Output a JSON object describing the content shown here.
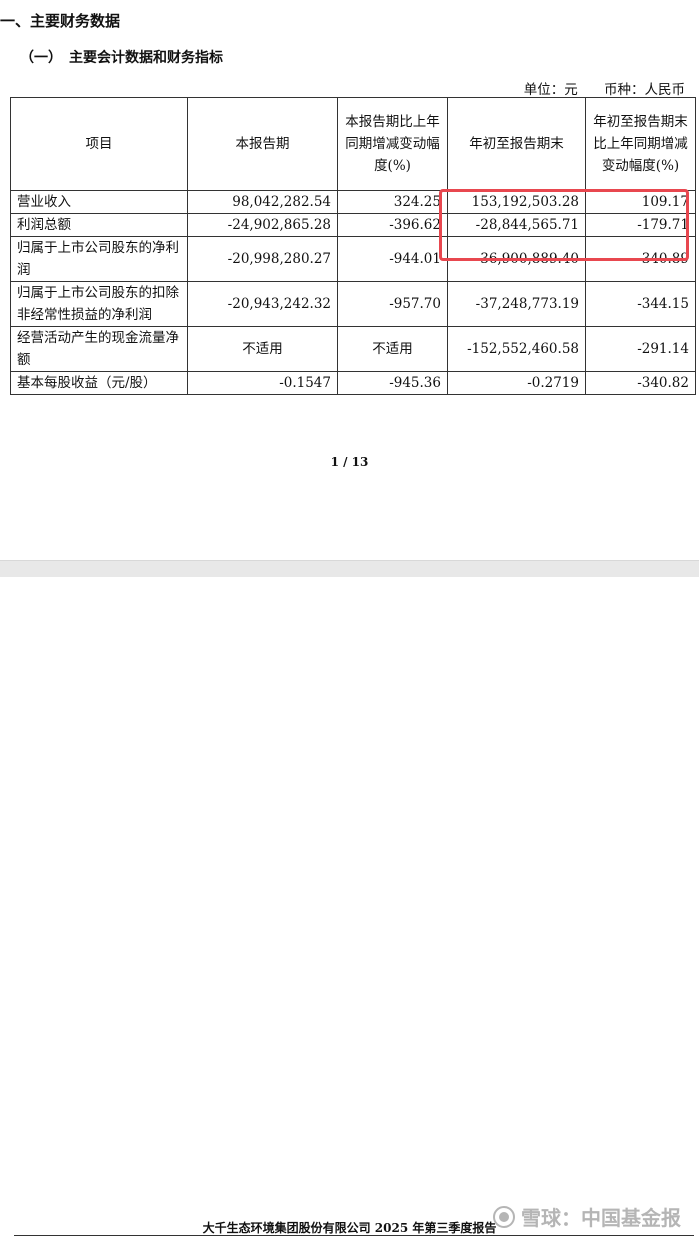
{
  "section_title": "一、主要财务数据",
  "sub_title": "（一）　主要会计数据和财务指标",
  "unit": {
    "unit_text": "单位：元",
    "currency_text": "币种：人民币"
  },
  "table": {
    "headers": [
      "项目",
      "本报告期",
      "本报告期比上年同期增减变动幅度(%)",
      "年初至报告期末",
      "年初至报告期末比上年同期增减变动幅度(%)"
    ],
    "rows": [
      {
        "label": "营业收入",
        "current": "98,042,282.54",
        "current_change": "324.25",
        "ytd": "153,192,503.28",
        "ytd_change": "109.17"
      },
      {
        "label": "利润总额",
        "current": "-24,902,865.28",
        "current_change": "-396.62",
        "ytd": "-28,844,565.71",
        "ytd_change": "-179.71"
      },
      {
        "label": "归属于上市公司股东的净利润",
        "current": "-20,998,280.27",
        "current_change": "-944.01",
        "ytd": "-36,900,889.40",
        "ytd_change": "-340.89"
      },
      {
        "label": "归属于上市公司股东的扣除非经常性损益的净利润",
        "current": "-20,943,242.32",
        "current_change": "-957.70",
        "ytd": "-37,248,773.19",
        "ytd_change": "-344.15"
      },
      {
        "label": "经营活动产生的现金流量净额",
        "current": "不适用",
        "current_change": "不适用",
        "ytd": "-152,552,460.58",
        "ytd_change": "-291.14"
      },
      {
        "label": "基本每股收益（元/股）",
        "current": "-0.1547",
        "current_change": "-945.36",
        "ytd": "-0.2719",
        "ytd_change": "-340.82"
      }
    ]
  },
  "page_number": "1 / 13",
  "footer": "大千生态环境集团股份有限公司  2025 年第三季度报告",
  "watermark": "雪球：中国基金报",
  "colors": {
    "highlight": "#e8474f",
    "gap": "#e8e8e8"
  }
}
